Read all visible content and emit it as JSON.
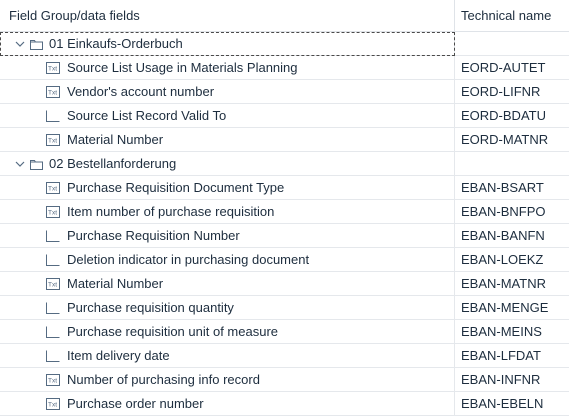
{
  "header": {
    "col_field": "Field Group/data fields",
    "col_technical": "Technical name"
  },
  "groups": [
    {
      "label": "01 Einkaufs-Orderbuch",
      "icon": "folder-icon",
      "expanded": true,
      "selected": true,
      "fields": [
        {
          "label": "Source List Usage in Materials Planning",
          "tech": "EORD-AUTET",
          "icon": "text-field-icon"
        },
        {
          "label": "Vendor's account number",
          "tech": "EORD-LIFNR",
          "icon": "text-field-icon"
        },
        {
          "label": "Source List Record Valid To",
          "tech": "EORD-BDATU",
          "icon": "value-field-icon"
        },
        {
          "label": "Material Number",
          "tech": "EORD-MATNR",
          "icon": "text-field-icon"
        }
      ]
    },
    {
      "label": "02 Bestellanforderung",
      "icon": "folder-icon",
      "expanded": true,
      "selected": false,
      "fields": [
        {
          "label": "Purchase Requisition Document Type",
          "tech": "EBAN-BSART",
          "icon": "text-field-icon"
        },
        {
          "label": "Item number of purchase requisition",
          "tech": "EBAN-BNFPO",
          "icon": "text-field-icon"
        },
        {
          "label": "Purchase Requisition Number",
          "tech": "EBAN-BANFN",
          "icon": "value-field-icon"
        },
        {
          "label": "Deletion indicator in purchasing document",
          "tech": "EBAN-LOEKZ",
          "icon": "value-field-icon"
        },
        {
          "label": "Material Number",
          "tech": "EBAN-MATNR",
          "icon": "text-field-icon"
        },
        {
          "label": "Purchase requisition quantity",
          "tech": "EBAN-MENGE",
          "icon": "value-field-icon"
        },
        {
          "label": "Purchase requisition unit of measure",
          "tech": "EBAN-MEINS",
          "icon": "value-field-icon"
        },
        {
          "label": "Item delivery date",
          "tech": "EBAN-LFDAT",
          "icon": "value-field-icon"
        },
        {
          "label": "Number of purchasing info record",
          "tech": "EBAN-INFNR",
          "icon": "text-field-icon"
        },
        {
          "label": "Purchase order number",
          "tech": "EBAN-EBELN",
          "icon": "text-field-icon"
        }
      ]
    }
  ],
  "colors": {
    "text": "#1d2d3e",
    "icon": "#556b82",
    "border": "#e5e8ec"
  }
}
